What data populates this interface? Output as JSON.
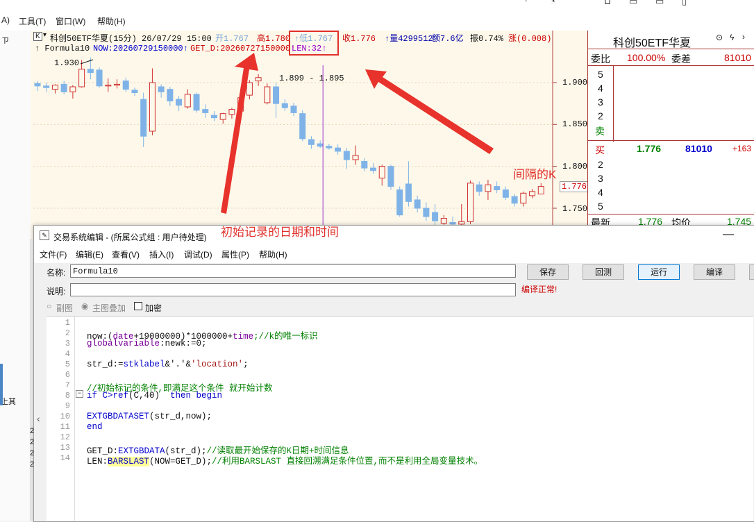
{
  "top_menu": {
    "item_a": "A)",
    "tools": "工具(T)",
    "window": "窗口(W)",
    "help": "帮助(H)"
  },
  "left_strip": {
    "pin": "ㄗ",
    "label": "上其"
  },
  "chart": {
    "header1": {
      "k_box": "K",
      "name": "科创50ETF华夏(15分) 26/07/29 15:00",
      "open": "开1.767",
      "high": "高1.780",
      "low": "↑低1.767",
      "close": "收1.776",
      "vol": "↑量4299512",
      "amount": "额7.6亿",
      "amp": "振0.74%",
      "chg": "涨(0.008)"
    },
    "header2": {
      "formula": "↑ Formula10",
      "now": "NOW:20260729150000↑",
      "get_d": "GET_D:20260727150000↑",
      "len": "LEN:32↑"
    },
    "hi_label": "1.930",
    "range_label": "1.899 - 1.895",
    "price_axis": [
      "1.900",
      "1.850",
      "1.800",
      "1.750"
    ],
    "last_price_tag": "1.776"
  },
  "chart_data": {
    "type": "candlestick",
    "y_ticks": [
      1.9,
      1.85,
      1.8,
      1.75
    ],
    "ylim": [
      1.72,
      1.95
    ],
    "candles": [
      {
        "o": 1.899,
        "h": 1.902,
        "l": 1.89,
        "c": 1.896
      },
      {
        "o": 1.896,
        "h": 1.9,
        "l": 1.889,
        "c": 1.894
      },
      {
        "o": 1.892,
        "h": 1.898,
        "l": 1.887,
        "c": 1.897
      },
      {
        "o": 1.898,
        "h": 1.902,
        "l": 1.886,
        "c": 1.889
      },
      {
        "o": 1.889,
        "h": 1.897,
        "l": 1.881,
        "c": 1.895
      },
      {
        "o": 1.895,
        "h": 1.927,
        "l": 1.894,
        "c": 1.916
      },
      {
        "o": 1.916,
        "h": 1.93,
        "l": 1.904,
        "c": 1.912
      },
      {
        "o": 1.915,
        "h": 1.918,
        "l": 1.894,
        "c": 1.896
      },
      {
        "o": 1.896,
        "h": 1.905,
        "l": 1.889,
        "c": 1.897
      },
      {
        "o": 1.897,
        "h": 1.904,
        "l": 1.893,
        "c": 1.898
      },
      {
        "o": 1.902,
        "h": 1.906,
        "l": 1.889,
        "c": 1.892
      },
      {
        "o": 1.891,
        "h": 1.894,
        "l": 1.884,
        "c": 1.888
      },
      {
        "o": 1.88,
        "h": 1.888,
        "l": 1.823,
        "c": 1.836
      },
      {
        "o": 1.842,
        "h": 1.917,
        "l": 1.837,
        "c": 1.9
      },
      {
        "o": 1.895,
        "h": 1.898,
        "l": 1.882,
        "c": 1.889
      },
      {
        "o": 1.892,
        "h": 1.895,
        "l": 1.872,
        "c": 1.878
      },
      {
        "o": 1.88,
        "h": 1.884,
        "l": 1.866,
        "c": 1.873
      },
      {
        "o": 1.871,
        "h": 1.892,
        "l": 1.869,
        "c": 1.886
      },
      {
        "o": 1.886,
        "h": 1.888,
        "l": 1.864,
        "c": 1.867
      },
      {
        "o": 1.868,
        "h": 1.874,
        "l": 1.858,
        "c": 1.864
      },
      {
        "o": 1.861,
        "h": 1.866,
        "l": 1.854,
        "c": 1.858
      },
      {
        "o": 1.856,
        "h": 1.864,
        "l": 1.851,
        "c": 1.863
      },
      {
        "o": 1.862,
        "h": 1.87,
        "l": 1.857,
        "c": 1.868
      },
      {
        "o": 1.866,
        "h": 1.885,
        "l": 1.862,
        "c": 1.882
      },
      {
        "o": 1.885,
        "h": 1.903,
        "l": 1.88,
        "c": 1.9
      },
      {
        "o": 1.902,
        "h": 1.91,
        "l": 1.896,
        "c": 1.906
      },
      {
        "o": 1.876,
        "h": 1.899,
        "l": 1.874,
        "c": 1.895
      },
      {
        "o": 1.895,
        "h": 1.9,
        "l": 1.858,
        "c": 1.875
      },
      {
        "o": 1.875,
        "h": 1.88,
        "l": 1.866,
        "c": 1.87
      },
      {
        "o": 1.872,
        "h": 1.876,
        "l": 1.86,
        "c": 1.864
      },
      {
        "o": 1.863,
        "h": 1.867,
        "l": 1.83,
        "c": 1.833
      },
      {
        "o": 1.832,
        "h": 1.836,
        "l": 1.821,
        "c": 1.826
      },
      {
        "o": 1.827,
        "h": 1.831,
        "l": 1.822,
        "c": 1.824
      },
      {
        "o": 1.824,
        "h": 1.827,
        "l": 1.82,
        "c": 1.822
      },
      {
        "o": 1.822,
        "h": 1.826,
        "l": 1.814,
        "c": 1.818
      },
      {
        "o": 1.818,
        "h": 1.822,
        "l": 1.797,
        "c": 1.808
      },
      {
        "o": 1.808,
        "h": 1.825,
        "l": 1.802,
        "c": 1.813
      },
      {
        "o": 1.806,
        "h": 1.81,
        "l": 1.794,
        "c": 1.798
      },
      {
        "o": 1.798,
        "h": 1.804,
        "l": 1.791,
        "c": 1.795
      },
      {
        "o": 1.786,
        "h": 1.802,
        "l": 1.777,
        "c": 1.8
      },
      {
        "o": 1.8,
        "h": 1.802,
        "l": 1.772,
        "c": 1.776
      },
      {
        "o": 1.772,
        "h": 1.776,
        "l": 1.74,
        "c": 1.742
      },
      {
        "o": 1.779,
        "h": 1.806,
        "l": 1.752,
        "c": 1.758
      },
      {
        "o": 1.76,
        "h": 1.765,
        "l": 1.745,
        "c": 1.75
      },
      {
        "o": 1.75,
        "h": 1.757,
        "l": 1.735,
        "c": 1.74
      },
      {
        "o": 1.745,
        "h": 1.755,
        "l": 1.728,
        "c": 1.735
      },
      {
        "o": 1.732,
        "h": 1.742,
        "l": 1.725,
        "c": 1.738
      },
      {
        "o": 1.733,
        "h": 1.74,
        "l": 1.726,
        "c": 1.731
      },
      {
        "o": 1.731,
        "h": 1.755,
        "l": 1.729,
        "c": 1.734
      },
      {
        "o": 1.734,
        "h": 1.783,
        "l": 1.731,
        "c": 1.78
      },
      {
        "o": 1.778,
        "h": 1.782,
        "l": 1.765,
        "c": 1.77
      },
      {
        "o": 1.77,
        "h": 1.784,
        "l": 1.76,
        "c": 1.778
      },
      {
        "o": 1.776,
        "h": 1.782,
        "l": 1.768,
        "c": 1.772
      },
      {
        "o": 1.772,
        "h": 1.776,
        "l": 1.76,
        "c": 1.763
      },
      {
        "o": 1.764,
        "h": 1.767,
        "l": 1.752,
        "c": 1.756
      },
      {
        "o": 1.756,
        "h": 1.77,
        "l": 1.752,
        "c": 1.768
      },
      {
        "o": 1.765,
        "h": 1.773,
        "l": 1.762,
        "c": 1.77
      },
      {
        "o": 1.767,
        "h": 1.78,
        "l": 1.767,
        "c": 1.776
      }
    ],
    "marker_index": 32
  },
  "right_panel": {
    "title": "科创50ETF华夏",
    "weibi_label": "委比",
    "weibi_value": "100.00%",
    "weicha_label": "委差",
    "weicha_value": "81010",
    "sell_levels": [
      "5",
      "4",
      "3",
      "2",
      "卖"
    ],
    "buy1_label": "买",
    "buy1_price": "1.776",
    "buy1_vol": "81010",
    "buy1_chg": "+163",
    "buy_levels": [
      "2",
      "3",
      "4",
      "5"
    ],
    "latest_label": "最新",
    "latest_value": "1.776",
    "avg_label": "均价",
    "avg_value": "1.745"
  },
  "annotations": {
    "start_record": "初始记录的日期和时间",
    "interval_k": "间隔的K"
  },
  "editor": {
    "title": "交易系统编辑 - (所属公式组 : 用户待处理)",
    "menu": [
      "文件(F)",
      "编辑(E)",
      "查看(V)",
      "插入(I)",
      "调试(D)",
      "属性(P)",
      "帮助(H)"
    ],
    "name_label": "名称:",
    "name_value": "Formula10",
    "desc_label": "说明:",
    "desc_value": "",
    "compile_status": "编译正常!",
    "buttons": {
      "save": "保存",
      "test": "回测",
      "run": "运行",
      "compile": "编译"
    },
    "radio_sub": "副图",
    "radio_main": "主图叠加",
    "checkbox_encrypt": "加密",
    "line_numbers": [
      "1",
      "2",
      "3",
      "4",
      "5",
      "6",
      "7",
      "8",
      "9",
      "10",
      "11",
      "12",
      "13",
      "14"
    ],
    "code_lines": {
      "l2a": "now:(",
      "l2b": "date",
      "l2c": "+19000000)*1000000+",
      "l2d": "time",
      "l2e": ";//k的唯一标识",
      "l3a": "globalvariable",
      "l3b": ":newk:=0;",
      "l5a": "str_d:=",
      "l5b": "stklabel",
      "l5c": "&'.'&",
      "l5d": "'location'",
      "l5e": ";",
      "l7": "//初始标记的条件,即满足这个条件 就开始计数",
      "l8a": "if C>",
      "l8b": "ref",
      "l8c": "(C,40)  ",
      "l8d": "then begin",
      "l10a": "EXTGBDATASET",
      "l10b": "(str_d,now);",
      "l11": "end",
      "l13a": "GET_D:",
      "l13b": "EXTGBDATA",
      "l13c": "(str_d);",
      "l13d": "//读取最开始保存的K日期+时间信息",
      "l14a": "LEN:",
      "l14b": "BARSLAST",
      "l14c": "(NOW=GET_D);",
      "l14d": "//利用BARSLAST 直接回溯满足条件位置,而不是利用全局变量技术。"
    },
    "left_side_nums": [
      "2",
      "2",
      "2",
      "2"
    ]
  }
}
